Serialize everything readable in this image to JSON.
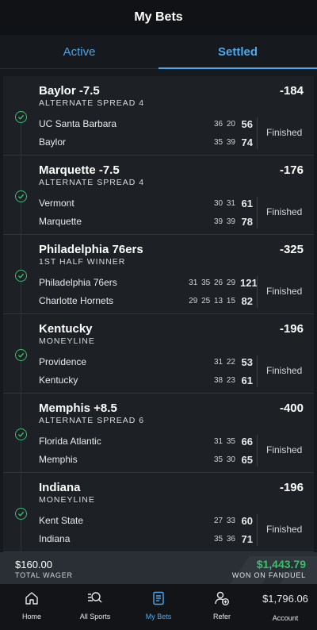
{
  "header": {
    "title": "My Bets"
  },
  "tabs": [
    {
      "label": "Active",
      "active": false
    },
    {
      "label": "Settled",
      "active": true
    }
  ],
  "bets": [
    {
      "title": "Baylor -7.5",
      "type": "ALTERNATE SPREAD 4",
      "odds": "-184",
      "team1": "UC Santa Barbara",
      "periods1": "36 20",
      "total1": "56",
      "team2": "Baylor",
      "periods2": "35 39",
      "total2": "74",
      "status": "Finished"
    },
    {
      "title": "Marquette -7.5",
      "type": "ALTERNATE SPREAD 4",
      "odds": "-176",
      "team1": "Vermont",
      "periods1": "30 31",
      "total1": "61",
      "team2": "Marquette",
      "periods2": "39 39",
      "total2": "78",
      "status": "Finished"
    },
    {
      "title": "Philadelphia 76ers",
      "type": "1ST HALF WINNER",
      "odds": "-325",
      "team1": "Philadelphia 76ers",
      "periods1": "31 35 26 29",
      "total1": "121",
      "team2": "Charlotte Hornets",
      "periods2": "29 25 13 15",
      "total2": "82",
      "status": "Finished"
    },
    {
      "title": "Kentucky",
      "type": "MONEYLINE",
      "odds": "-196",
      "team1": "Providence",
      "periods1": "31 22",
      "total1": "53",
      "team2": "Kentucky",
      "periods2": "38 23",
      "total2": "61",
      "status": "Finished"
    },
    {
      "title": "Memphis +8.5",
      "type": "ALTERNATE SPREAD 6",
      "odds": "-400",
      "team1": "Florida Atlantic",
      "periods1": "31 35",
      "total1": "66",
      "team2": "Memphis",
      "periods2": "35 30",
      "total2": "65",
      "status": "Finished"
    },
    {
      "title": "Indiana",
      "type": "MONEYLINE",
      "odds": "-196",
      "team1": "Kent State",
      "periods1": "27 33",
      "total1": "60",
      "team2": "Indiana",
      "periods2": "35 36",
      "total2": "71",
      "status": "Finished"
    }
  ],
  "summary": {
    "wager_amount": "$160.00",
    "wager_label": "TOTAL WAGER",
    "won_amount": "$1,443.79",
    "won_label": "WON ON FANDUEL"
  },
  "nav": {
    "home": "Home",
    "all_sports": "All Sports",
    "my_bets": "My Bets",
    "refer": "Refer",
    "balance": "$1,796.06",
    "account": "Account"
  },
  "colors": {
    "accent": "#4aa9f0",
    "success": "#36c06a",
    "background": "#16191d"
  }
}
